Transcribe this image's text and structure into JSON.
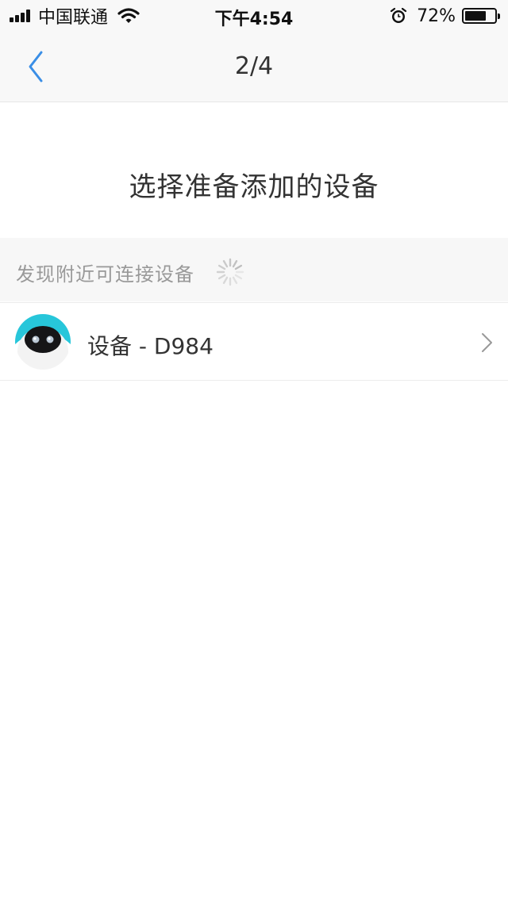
{
  "status_bar": {
    "carrier": "中国联通",
    "time": "下午4:54",
    "battery_percent": "72%",
    "battery_level": 0.72,
    "icons": [
      "signal-icon",
      "wifi-icon",
      "alarm-icon",
      "battery-icon"
    ]
  },
  "nav": {
    "title": "2/4",
    "back_icon": "chevron-left-icon",
    "accent_color": "#3a8ee6"
  },
  "page": {
    "title": "选择准备添加的设备"
  },
  "section": {
    "label": "发现附近可连接设备",
    "spinner_icon": "loading-spinner-icon"
  },
  "devices": [
    {
      "name": "设备 - D984",
      "icon": "robot-avatar-icon",
      "chevron_icon": "chevron-right-icon"
    }
  ]
}
